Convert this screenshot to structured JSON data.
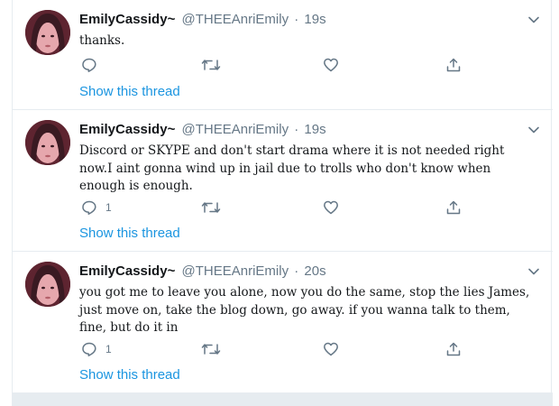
{
  "thread_label": "Show this thread",
  "tweets": [
    {
      "display_name": "EmilyCassidy",
      "name_suffix": "~",
      "handle": "@THEEAnriEmily",
      "separator": "·",
      "time": "19s",
      "text": "thanks.",
      "reply_count": "",
      "thread_link": "Show this thread"
    },
    {
      "display_name": "EmilyCassidy",
      "name_suffix": "~",
      "handle": "@THEEAnriEmily",
      "separator": "·",
      "time": "19s",
      "text": "Discord or SKYPE and don't start drama where it is not needed right now.I aint gonna wind up in jail due to trolls who don't know when enough is enough.",
      "reply_count": "1",
      "thread_link": "Show this thread"
    },
    {
      "display_name": "EmilyCassidy",
      "name_suffix": "~",
      "handle": "@THEEAnriEmily",
      "separator": "·",
      "time": "20s",
      "text": "you got me to leave you alone, now you do the same, stop the lies James, just move on, take the blog down, go away. if you wanna talk to them, fine, but do it in",
      "reply_count": "1",
      "thread_link": "Show this thread"
    }
  ],
  "icons": {
    "reply": "reply-icon",
    "retweet": "retweet-icon",
    "like": "like-icon",
    "share": "share-icon",
    "caret": "chevron-down-icon"
  },
  "colors": {
    "link": "#1b95e0",
    "secondary": "#657786",
    "border": "#e6ecf0"
  }
}
